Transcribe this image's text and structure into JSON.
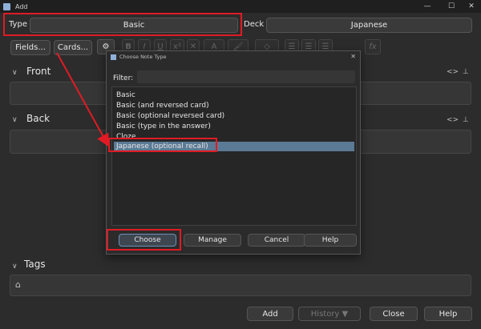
{
  "window": {
    "title": "Add",
    "controls": [
      "—",
      "☐",
      "✕"
    ]
  },
  "type_label": "Type",
  "type_value": "Basic",
  "deck_label": "Deck",
  "deck_value": "Japanese",
  "fields_button": "Fields...",
  "cards_button": "Cards...",
  "toolbar": {
    "gear": "⚙",
    "bold": "B",
    "italic": "I",
    "underline": "U",
    "superscript": "x²",
    "clear": "✕",
    "text_color": "A",
    "highlight": "🖌",
    "eraser": "◇",
    "list_unordered": "☰",
    "list_ordered": "☰",
    "indent": "☰",
    "math": "fx"
  },
  "sections": {
    "front": {
      "chevron": "∨",
      "title": "Front"
    },
    "back": {
      "chevron": "∨",
      "title": "Back"
    },
    "tags": {
      "chevron": "∨",
      "title": "Tags",
      "tag_icon": "⌂"
    }
  },
  "field_icons": {
    "html": "<>",
    "pin": "⊥"
  },
  "bottom_buttons": {
    "add": "Add",
    "history": "History ▼",
    "close": "Close",
    "help": "Help"
  },
  "dialog": {
    "title": "Choose Note Type",
    "close": "✕",
    "filter_label": "Filter:",
    "filter_value": "",
    "note_types": [
      "Basic",
      "Basic (and reversed card)",
      "Basic (optional reversed card)",
      "Basic (type in the answer)",
      "Cloze",
      "Japanese (optional recall)"
    ],
    "selected_index": 5,
    "buttons": {
      "choose": "Choose",
      "manage": "Manage",
      "cancel": "Cancel",
      "help": "Help"
    }
  },
  "colors": {
    "highlight_red": "#e01b24",
    "selection_blue": "#5b7a95"
  }
}
